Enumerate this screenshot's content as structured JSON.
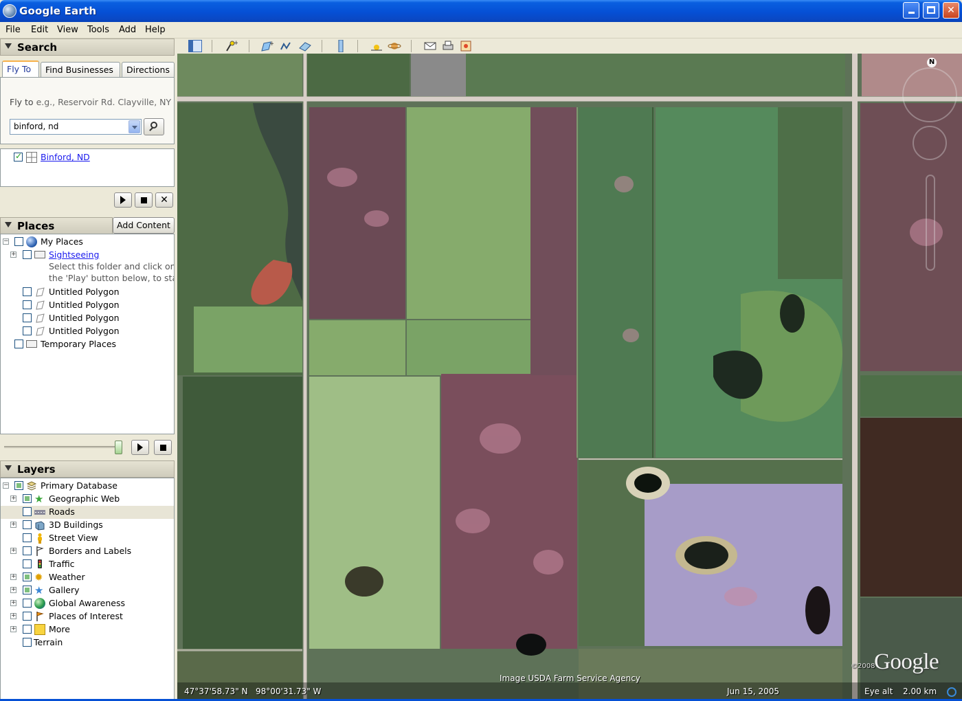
{
  "window": {
    "title": "Google Earth",
    "controls": [
      "minimize-icon",
      "maximize-icon",
      "close-icon"
    ]
  },
  "menubar": [
    "File",
    "Edit",
    "View",
    "Tools",
    "Add",
    "Help"
  ],
  "search": {
    "header": "Search",
    "tabs": [
      "Fly To",
      "Find Businesses",
      "Directions"
    ],
    "flyto_label": "Fly to",
    "flyto_hint": "e.g., Reservoir Rd. Clayville, NY",
    "input_value": "binford, nd",
    "result": "Binford, ND"
  },
  "places": {
    "header": "Places",
    "add_content": "Add Content",
    "items": [
      {
        "label": "My Places",
        "icon": "globe-icon"
      },
      {
        "label": "Sightseeing",
        "icon": "folder-icon"
      },
      {
        "label": "Select this folder and click on"
      },
      {
        "label": "the 'Play' button below, to start"
      },
      {
        "label": "Untitled Polygon",
        "icon": "polygon-icon"
      },
      {
        "label": "Untitled Polygon",
        "icon": "polygon-icon"
      },
      {
        "label": "Untitled Polygon",
        "icon": "polygon-icon"
      },
      {
        "label": "Untitled Polygon",
        "icon": "polygon-icon"
      },
      {
        "label": "Temporary Places",
        "icon": "folder-icon"
      }
    ]
  },
  "layers": {
    "header": "Layers",
    "items": [
      {
        "label": "Primary Database",
        "icon": "database-icon"
      },
      {
        "label": "Geographic Web",
        "icon": "star-icon"
      },
      {
        "label": "Roads",
        "icon": "road-icon"
      },
      {
        "label": "3D Buildings",
        "icon": "building-icon"
      },
      {
        "label": "Street View",
        "icon": "pegman-icon"
      },
      {
        "label": "Borders and Labels",
        "icon": "flag-icon"
      },
      {
        "label": "Traffic",
        "icon": "traffic-light-icon"
      },
      {
        "label": "Weather",
        "icon": "sun-icon"
      },
      {
        "label": "Gallery",
        "icon": "star-icon"
      },
      {
        "label": "Global Awareness",
        "icon": "globe-icon"
      },
      {
        "label": "Places of Interest",
        "icon": "flag-icon"
      },
      {
        "label": "More",
        "icon": "note-icon"
      },
      {
        "label": "Terrain"
      }
    ]
  },
  "status": {
    "imagery_credit": "Image USDA Farm Service Agency",
    "latitude": "47°37'58.73\" N",
    "longitude": "98°00'31.73\" W",
    "date": "Jun 15, 2005",
    "eye_alt_label": "Eye alt",
    "eye_alt_value": "2.00 km",
    "logo": "Google",
    "copyright": "©2008",
    "compass": "N"
  },
  "colors": {
    "title_bar": "#0550d5",
    "link": "#1a1aee",
    "panel_bg": "#ece9d8"
  }
}
